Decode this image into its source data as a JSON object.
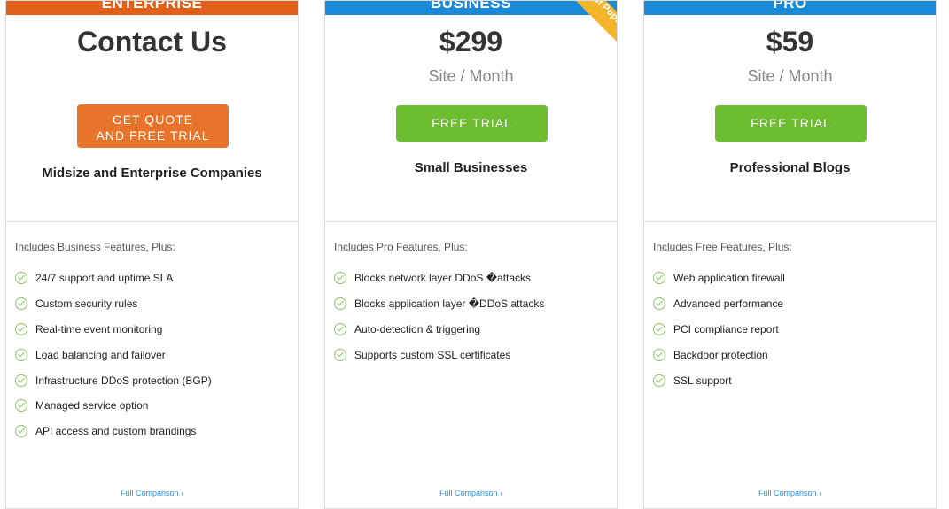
{
  "colors": {
    "enterprise": "#e0601a",
    "business": "#1a8ad8",
    "pro": "#1a8ad8",
    "ribbon": "#f5b52a"
  },
  "plans": [
    {
      "header": "ENTERPRISE",
      "price": "Contact Us",
      "unit": "",
      "button_line1": "GET QUOTE",
      "button_line2": "AND FREE TRIAL",
      "audience": "Midsize and Enterprise Companies",
      "includes": "Includes Business Features, Plus:",
      "features": [
        "24/7 support and uptime SLA",
        "Custom security rules",
        "Real-time event monitoring",
        "Load balancing and failover",
        "Infrastructure DDoS protection (BGP)",
        "Managed service option",
        "API access and custom brandings"
      ],
      "compare": "Full Comparison ›"
    },
    {
      "header": "BUSINESS",
      "ribbon": "Most Popular",
      "price": "$299",
      "unit": "Site / Month",
      "button": "FREE TRIAL",
      "audience": "Small Businesses",
      "includes": "Includes Pro Features, Plus:",
      "features": [
        "Blocks network layer DDoS �attacks",
        "Blocks application layer �DDoS attacks",
        "Auto-detection & triggering",
        "Supports custom SSL certificates"
      ],
      "compare": "Full Comparison ›"
    },
    {
      "header": "PRO",
      "price": "$59",
      "unit": "Site / Month",
      "button": "FREE TRIAL",
      "audience": "Professional Blogs",
      "includes": "Includes Free Features, Plus:",
      "features": [
        "Web application firewall",
        "Advanced performance",
        "PCI compliance report",
        "Backdoor protection",
        "SSL support"
      ],
      "compare": "Full Comparison ›"
    }
  ]
}
